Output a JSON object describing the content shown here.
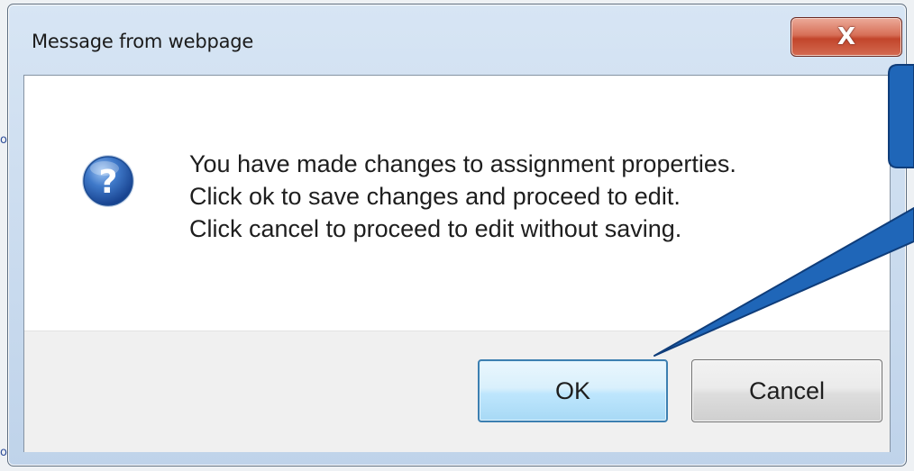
{
  "backdrop": {
    "link_fragment_top": "ot",
    "link_fragment_bottom": "ot"
  },
  "dialog": {
    "title": "Message from webpage",
    "close_icon": "close-icon",
    "close_glyph": "X",
    "message_icon": "question-icon",
    "message_lines": [
      "You have made changes to assignment properties.",
      "Click ok to save changes and proceed to edit.",
      "Click cancel to proceed to edit without saving."
    ],
    "buttons": {
      "ok_label": "OK",
      "cancel_label": "Cancel"
    }
  },
  "callout": {
    "color": "#1f66b8",
    "border_color": "#0f3d7a"
  }
}
